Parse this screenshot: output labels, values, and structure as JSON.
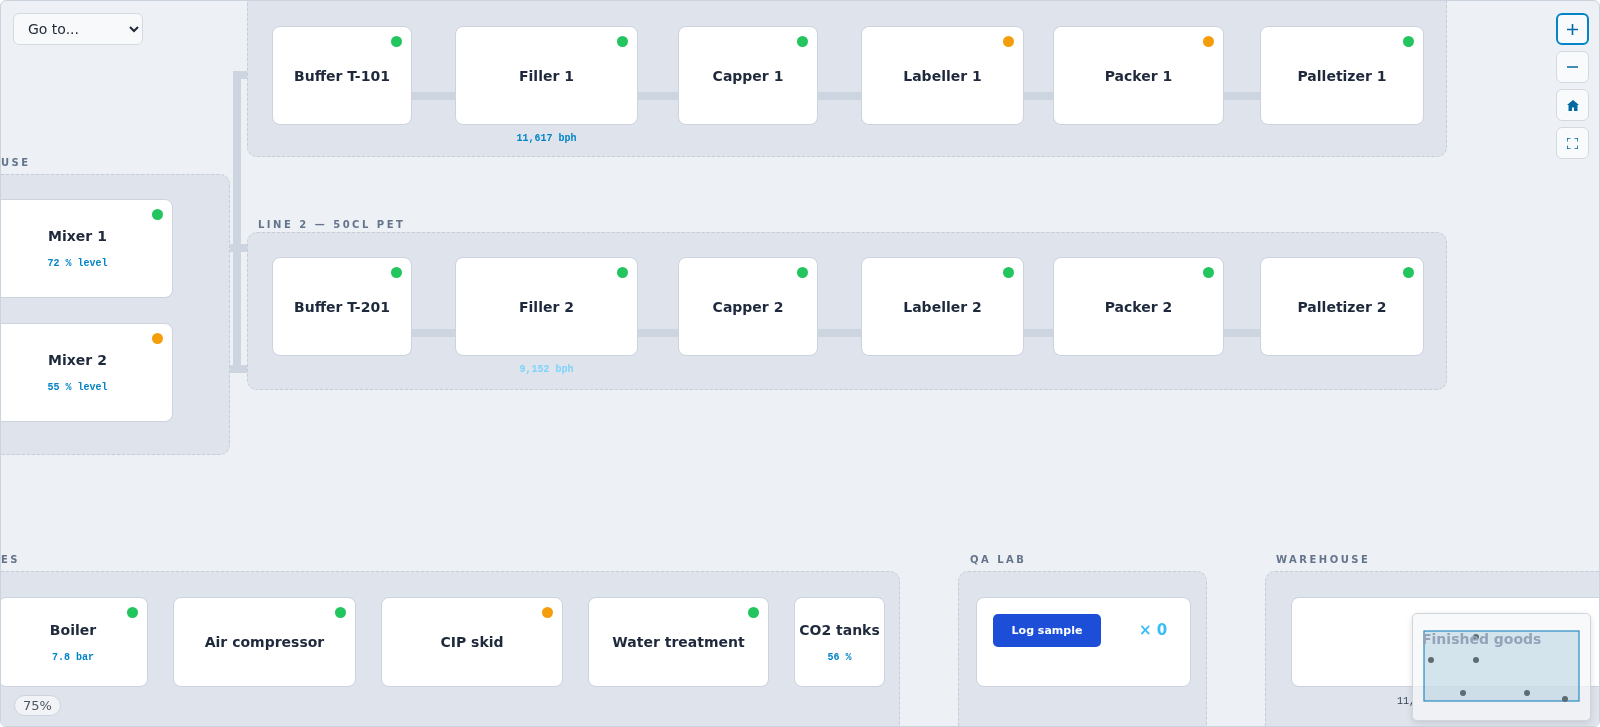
{
  "goto": {
    "value": "Go to..."
  },
  "groups": [
    {
      "kind": "line",
      "nodes": [
        {
          "name": "Buffer T-101",
          "color": "#22c55e"
        },
        {
          "name": "Filler 1",
          "color": "#22c55e",
          "metric": {
            "text": "11,617 bph",
            "color": "#0284c7"
          }
        },
        {
          "name": "Capper 1",
          "color": "#22c55e"
        },
        {
          "name": "Labeller 1",
          "color": "#f59e0b"
        },
        {
          "name": "Packer 1",
          "color": "#f59e0b"
        },
        {
          "name": "Palletizer 1",
          "color": "#22c55e"
        }
      ]
    },
    {
      "kind": "line",
      "label": "LINE 2 — 50CL PET",
      "nodes": [
        {
          "name": "Buffer T-201",
          "color": "#22c55e"
        },
        {
          "name": "Filler 2",
          "color": "#22c55e",
          "metric": {
            "text": "9,152 bph",
            "color": "#7dd3fc"
          }
        },
        {
          "name": "Capper 2",
          "color": "#22c55e"
        },
        {
          "name": "Labeller 2",
          "color": "#22c55e"
        },
        {
          "name": "Packer 2",
          "color": "#22c55e"
        },
        {
          "name": "Palletizer 2",
          "color": "#22c55e"
        }
      ]
    },
    {
      "kind": "column",
      "label": "USE",
      "nodes": [
        {
          "name": "Mixer 1",
          "color": "#22c55e",
          "metric": {
            "text": "72 % level",
            "color": "#0284c7"
          }
        },
        {
          "name": "Mixer 2",
          "color": "#f59e0b",
          "metric": {
            "text": "55 % level",
            "color": "#0284c7"
          }
        }
      ]
    },
    {
      "kind": "utilities",
      "label": "ES",
      "nodes": [
        {
          "name": "Boiler",
          "color": "#22c55e",
          "metric": {
            "text": "7.8 bar",
            "color": "#0284c7"
          }
        },
        {
          "name": "Air compressor",
          "color": "#22c55e"
        },
        {
          "name": "CIP skid",
          "color": "#f59e0b"
        },
        {
          "name": "Water treatment",
          "color": "#22c55e"
        },
        {
          "name": "CO2 tanks",
          "metric": {
            "text": "56 %",
            "color": "#0284c7"
          }
        }
      ]
    },
    {
      "kind": "qa",
      "label": "QA LAB",
      "button": "Log sample",
      "count": "× 0"
    },
    {
      "kind": "warehouse",
      "label": "WAREHOUSE",
      "nodes": [
        {
          "name": "Finished goods",
          "metric": {
            "text": "11,",
            "color": "#334155"
          }
        }
      ]
    }
  ],
  "zoom": "75%"
}
